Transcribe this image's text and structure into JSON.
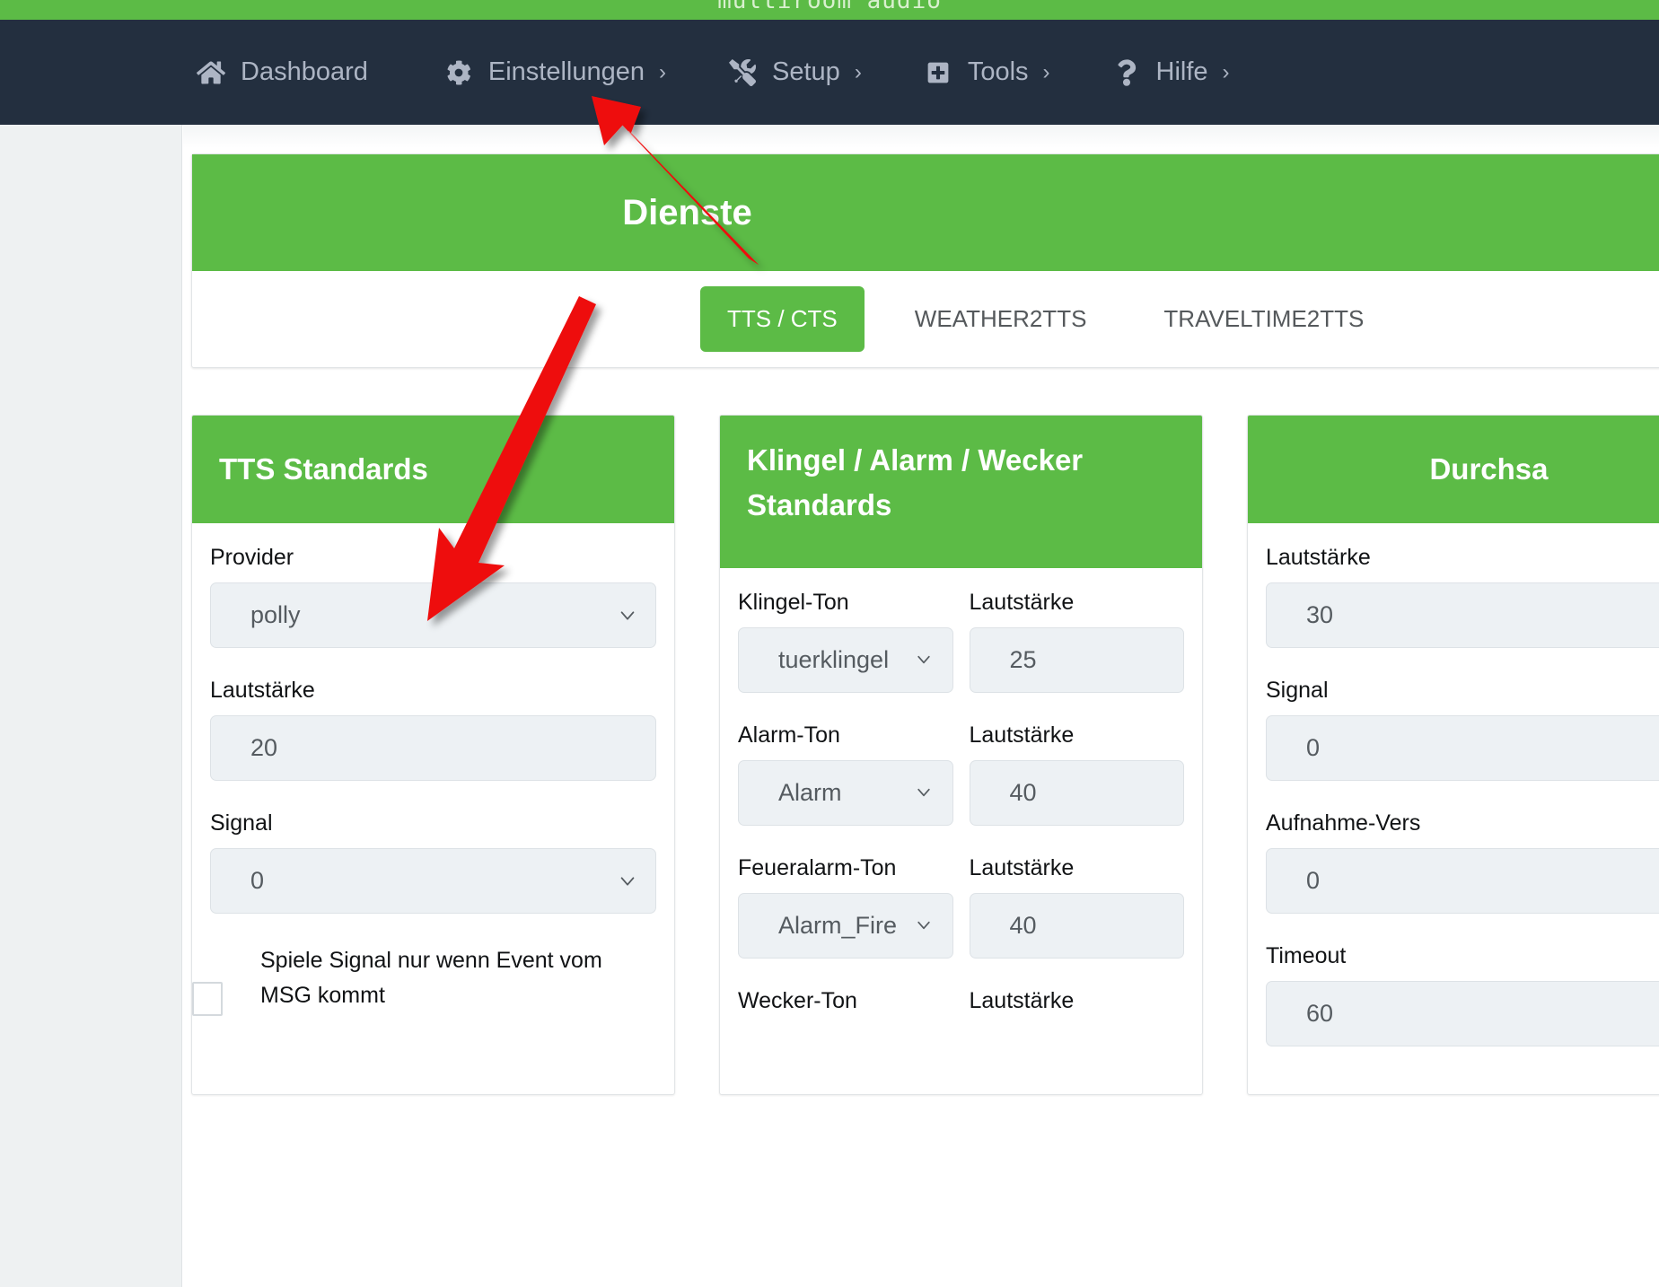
{
  "brand": {
    "name": "multiroom audio"
  },
  "navbar": {
    "items": [
      {
        "label": "Dashboard",
        "icon": "home-icon",
        "caret": ""
      },
      {
        "label": "Einstellungen",
        "icon": "gear-icon",
        "caret": "›"
      },
      {
        "label": "Setup",
        "icon": "tools-icon",
        "caret": "›"
      },
      {
        "label": "Tools",
        "icon": "plus-square-icon",
        "caret": "›"
      },
      {
        "label": "Hilfe",
        "icon": "question-icon",
        "caret": "›"
      }
    ]
  },
  "page": {
    "panel_title": "Dienste",
    "tabs": [
      {
        "label": "TTS / CTS",
        "active": true
      },
      {
        "label": "WEATHER2TTS",
        "active": false
      },
      {
        "label": "TRAVELTIME2TTS",
        "active": false
      }
    ]
  },
  "cards": {
    "tts": {
      "title": "TTS Standards",
      "provider_label": "Provider",
      "provider_value": "polly",
      "volume_label": "Lautstärke",
      "volume_value": "20",
      "signal_label": "Signal",
      "signal_value": "0",
      "checkbox_label": "Spiele Signal nur wenn Event vom MSG kommt"
    },
    "klingel": {
      "title": "Klingel / Alarm / Wecker Standards",
      "rows": [
        {
          "tone_label": "Klingel-Ton",
          "tone_value": "tuerklingel",
          "vol_label": "Lautstärke",
          "vol_value": "25"
        },
        {
          "tone_label": "Alarm-Ton",
          "tone_value": "Alarm",
          "vol_label": "Lautstärke",
          "vol_value": "40"
        },
        {
          "tone_label": "Feueralarm-Ton",
          "tone_value": "Alarm_Fire",
          "vol_label": "Lautstärke",
          "vol_value": "40"
        },
        {
          "tone_label": "Wecker-Ton",
          "tone_value": "",
          "vol_label": "Lautstärke",
          "vol_value": ""
        }
      ]
    },
    "durchsage": {
      "title": "Durchsa",
      "volume_label": "Lautstärke",
      "volume_value": "30",
      "signal_label": "Signal",
      "signal_value": "0",
      "attempts_label": "Aufnahme-Vers",
      "attempts_value": "0",
      "timeout_label": "Timeout",
      "timeout_value": "60"
    }
  },
  "colors": {
    "green": "#5cbb46",
    "navy": "#232f3f",
    "nav_text": "#adb5c4",
    "field_bg": "#edf1f4",
    "annotation_red": "#ee1111"
  }
}
